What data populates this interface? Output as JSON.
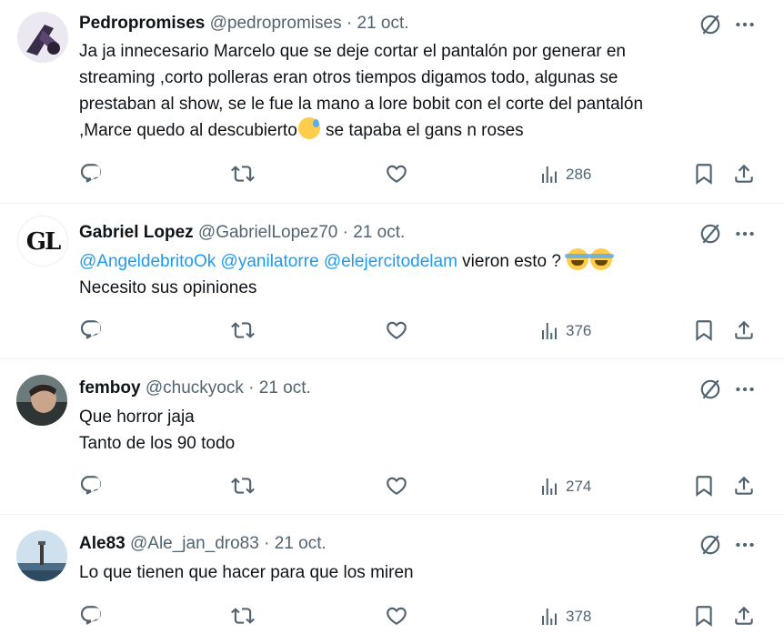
{
  "tweets": [
    {
      "name": "Pedropromises",
      "handle": "@pedropromises",
      "date": "21 oct.",
      "lines": [
        "Ja ja innecesario Marcelo que se deje cortar el pantalón  por generar en",
        "streaming ,corto polleras eran otros tiempos digamos todo, algunas se",
        "prestaban al show, se le fue la mano a lore bobit con el corte del pantalón",
        ",Marce quedo al descubierto",
        " se tapaba el gans n roses"
      ],
      "emoji": "sweat-smile-icon",
      "views": "286"
    },
    {
      "name": "Gabriel Lopez",
      "handle": "@GabrielLopez70",
      "date": "21 oct.",
      "avatar_text": "GL",
      "mentions": [
        "@AngeldebritoOk",
        "@yanilatorre",
        "@elejercitodelam"
      ],
      "after_mentions": " vieron esto ? ",
      "line2": "Necesito sus opiniones",
      "emoji": "tears-of-joy-icon",
      "views": "376"
    },
    {
      "name": "femboy",
      "handle": "@chuckyock",
      "date": "21 oct.",
      "lines": [
        "Que horror jaja",
        "Tanto de los 90 todo"
      ],
      "views": "274"
    },
    {
      "name": "Ale83",
      "handle": "@Ale_jan_dro83",
      "date": "21 oct.",
      "lines": [
        "Lo que tienen que hacer para que los miren"
      ],
      "views": "378"
    }
  ],
  "separator": "·",
  "colors": {
    "text": "#0f1419",
    "muted": "#536471",
    "link": "#1d9bf0",
    "border": "#eff3f4"
  }
}
